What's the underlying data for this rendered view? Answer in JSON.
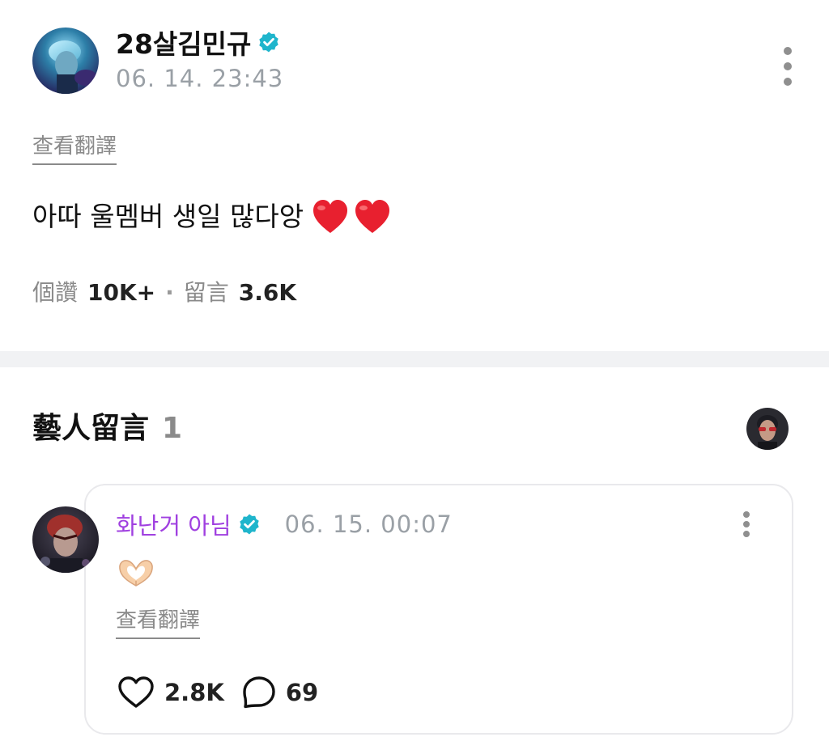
{
  "post": {
    "author": "28살김민규",
    "timestamp": "06. 14. 23:43",
    "translate_label": "查看翻譯",
    "body": "아따 울멤버 생일 많다앙",
    "stats": {
      "likes_label": "個讚",
      "likes_value": "10K+",
      "separator": "·",
      "comments_label": "留言",
      "comments_value": "3.6K"
    }
  },
  "artist_comments": {
    "title": "藝人留言",
    "count": "1",
    "comments": [
      {
        "author": "화난거 아님",
        "timestamp": "06. 15. 00:07",
        "translate_label": "查看翻譯",
        "likes": "2.8K",
        "replies": "69"
      }
    ]
  },
  "colors": {
    "verified": "#1fb5cc",
    "comment_author": "#a040e0",
    "heart_emoji": "#e8202f",
    "muted_text": "#9aa0a6",
    "divider": "#f1f2f4"
  },
  "icons": {
    "verified": "verified-badge-icon",
    "more": "more-vertical-icon",
    "heart_emoji": "red-heart-emoji",
    "heart_hands_emoji": "heart-hands-emoji",
    "like": "heart-outline-icon",
    "reply": "speech-bubble-icon"
  }
}
